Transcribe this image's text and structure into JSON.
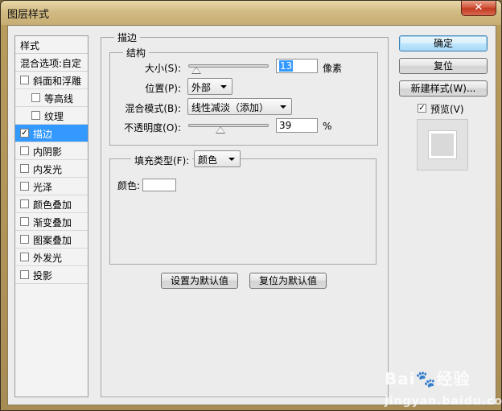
{
  "window": {
    "title": "图层样式",
    "close_glyph": "✕"
  },
  "styles": {
    "header": "样式",
    "blend_options": "混合选项:自定",
    "items": [
      {
        "label": "斜面和浮雕",
        "checked": false,
        "indent": false,
        "active": false
      },
      {
        "label": "等高线",
        "checked": false,
        "indent": true,
        "active": false
      },
      {
        "label": "纹理",
        "checked": false,
        "indent": true,
        "active": false
      },
      {
        "label": "描边",
        "checked": true,
        "indent": false,
        "active": true
      },
      {
        "label": "内阴影",
        "checked": false,
        "indent": false,
        "active": false
      },
      {
        "label": "内发光",
        "checked": false,
        "indent": false,
        "active": false
      },
      {
        "label": "光泽",
        "checked": false,
        "indent": false,
        "active": false
      },
      {
        "label": "颜色叠加",
        "checked": false,
        "indent": false,
        "active": false
      },
      {
        "label": "渐变叠加",
        "checked": false,
        "indent": false,
        "active": false
      },
      {
        "label": "图案叠加",
        "checked": false,
        "indent": false,
        "active": false
      },
      {
        "label": "外发光",
        "checked": false,
        "indent": false,
        "active": false
      },
      {
        "label": "投影",
        "checked": false,
        "indent": false,
        "active": false
      }
    ]
  },
  "stroke": {
    "title": "描边",
    "structure": {
      "title": "结构",
      "size_label": "大小(S):",
      "size_value": "13",
      "size_unit": "像素",
      "position_label": "位置(P):",
      "position_value": "外部",
      "blend_mode_label": "混合模式(B):",
      "blend_mode_value": "线性减淡（添加）",
      "opacity_label": "不透明度(O):",
      "opacity_value": "39",
      "opacity_unit": "%"
    },
    "fill": {
      "fill_type_label": "填充类型(F):",
      "fill_type_value": "颜色",
      "color_label": "颜色:",
      "color_value": "#ffffff"
    },
    "set_default_button": "设置为默认值",
    "reset_default_button": "复位为默认值"
  },
  "actions": {
    "ok_button": "确定",
    "reset_button": "复位",
    "new_style_button": "新建样式(W)...",
    "preview_label": "预览(V)",
    "preview_checked": true
  },
  "watermark": {
    "brand": "Bai",
    "paw": "🐾",
    "brand2": "经验",
    "sub": "jingyan.baidu.com"
  }
}
